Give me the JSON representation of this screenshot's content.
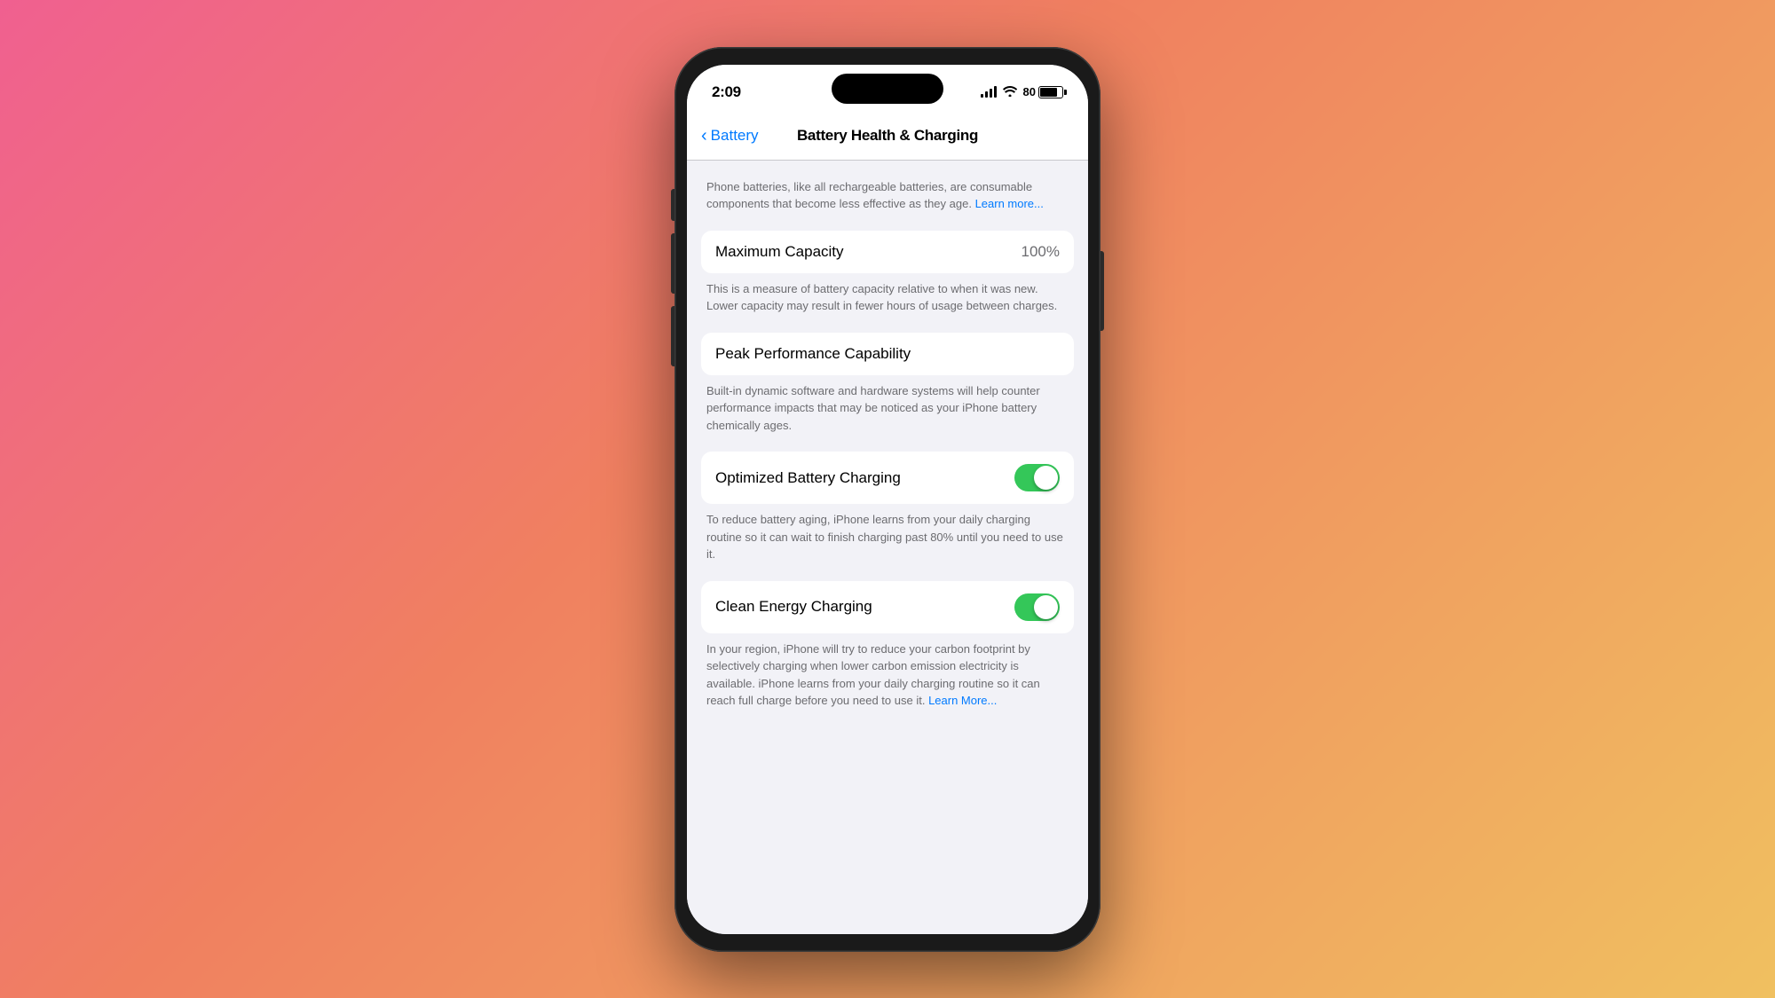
{
  "background": {
    "gradient": "linear-gradient(135deg, #f06090 0%, #f08060 40%, #f0c060 100%)"
  },
  "statusBar": {
    "time": "2:09",
    "batteryLevel": "80",
    "batteryPercent": "80%"
  },
  "navBar": {
    "backLabel": "Battery",
    "title": "Battery Health & Charging"
  },
  "intro": {
    "text": "Phone batteries, like all rechargeable batteries, are consumable components that become less effective as they age.",
    "learnMore": "Learn more..."
  },
  "maximumCapacity": {
    "label": "Maximum Capacity",
    "value": "100%",
    "description": "This is a measure of battery capacity relative to when it was new. Lower capacity may result in fewer hours of usage between charges."
  },
  "peakPerformance": {
    "label": "Peak Performance Capability",
    "description": "Built-in dynamic software and hardware systems will help counter performance impacts that may be noticed as your iPhone battery chemically ages."
  },
  "optimizedCharging": {
    "label": "Optimized Battery Charging",
    "enabled": true,
    "description": "To reduce battery aging, iPhone learns from your daily charging routine so it can wait to finish charging past 80% until you need to use it."
  },
  "cleanEnergy": {
    "label": "Clean Energy Charging",
    "enabled": true,
    "description": "In your region, iPhone will try to reduce your carbon footprint by selectively charging when lower carbon emission electricity is available. iPhone learns from your daily charging routine so it can reach full charge before you need to use it.",
    "learnMore": "Learn More..."
  }
}
